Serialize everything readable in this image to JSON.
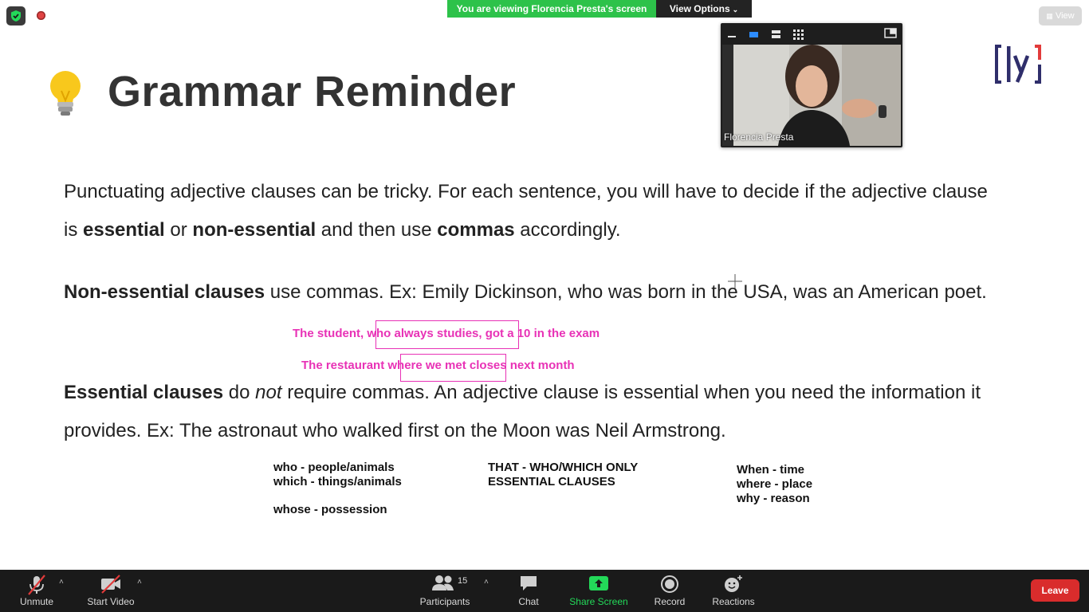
{
  "top_bar": {
    "viewing_banner": "You are viewing Florencia Presta's screen",
    "view_options_label": "View Options",
    "view_button_label": "View"
  },
  "video": {
    "participant_name": "Florencia Presta"
  },
  "slide": {
    "title": "Grammar Reminder",
    "intro": {
      "t1": "Punctuating adjective clauses can be tricky. For each sentence, you will have to decide if the adjective clause is ",
      "b1": "essential",
      "t2": " or ",
      "b2": "non-essential",
      "t3": " and then use ",
      "b3": "commas",
      "t4": " accordingly."
    },
    "nonessential": {
      "b1": "Non-essential clauses",
      "t1": " use commas. Ex: Emily Dickinson, who was born in the USA, was an American poet."
    },
    "essential": {
      "b1": "Essential clauses",
      "t1": " do ",
      "i1": "not",
      "t2": " require commas. An adjective clause is essential when you need the information it provides. Ex: The astronaut  who walked first on the Moon was Neil Armstrong."
    },
    "annotations": {
      "line1": "The student, who always studies, got a 10 in the exam",
      "line2": "The restaurant where we met closes next month"
    },
    "notes": {
      "who": "who - people/animals",
      "which": "which - things/animals",
      "whose": "whose - possession",
      "that_1": "THAT - WHO/WHICH ONLY",
      "that_2": "ESSENTIAL CLAUSES",
      "when": "When - time",
      "where": "where - place",
      "why": "why - reason"
    }
  },
  "toolbar": {
    "unmute": "Unmute",
    "start_video": "Start Video",
    "participants": "Participants",
    "participants_count": "15",
    "chat": "Chat",
    "share_screen": "Share Screen",
    "record": "Record",
    "reactions": "Reactions",
    "leave": "Leave"
  },
  "colors": {
    "banner_green": "#2dc24a",
    "annotation_pink": "#e832b6",
    "leave_red": "#d92c2c",
    "share_green": "#23d959",
    "toolbar_bg": "#1a1a1a"
  },
  "icons": [
    "shield-icon",
    "recording-icon",
    "lightbulb-icon",
    "mic-muted-icon",
    "video-off-icon",
    "participants-icon",
    "chat-icon",
    "share-screen-icon",
    "record-icon",
    "reactions-icon"
  ]
}
